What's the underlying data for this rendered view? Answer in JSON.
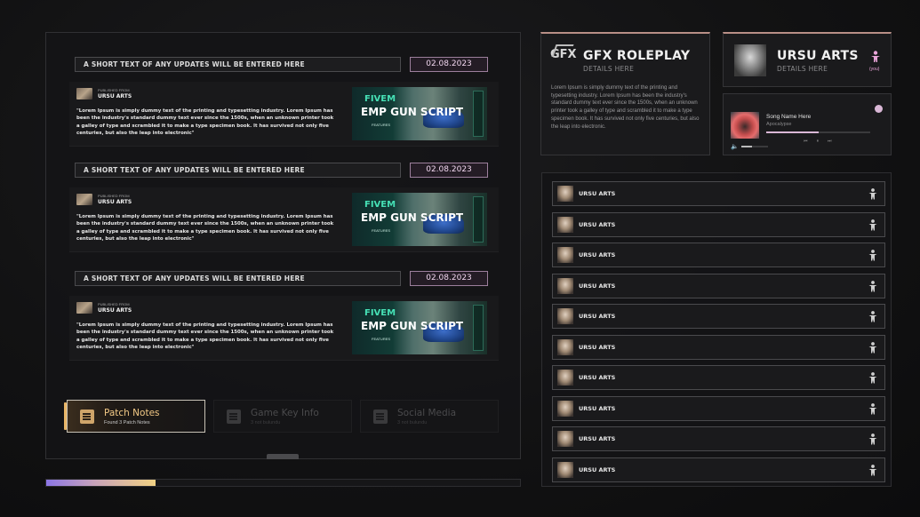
{
  "updates": [
    {
      "title": "A SHORT TEXT OF ANY UPDATES WILL BE ENTERED HERE",
      "date": "02.08.2023",
      "published_from": "PUBLISHED FROM",
      "author": "URSU ARTS",
      "text": "\"Lorem Ipsum is simply dummy text of the printing and typesetting industry. Lorem Ipsum has been the industry's standard dummy text ever since the 1500s, when an unknown printer took a galley of type and scrambled it to make a type specimen book. It has survived not only five centuries, but also the leap into electronic\"",
      "thumb_line1": "FIVEM",
      "thumb_line2": "EMP GUN SCRIPT",
      "thumb_line3": "FEATURES"
    },
    {
      "title": "A SHORT TEXT OF ANY UPDATES WILL BE ENTERED HERE",
      "date": "02.08.2023",
      "published_from": "PUBLISHED FROM",
      "author": "URSU ARTS",
      "text": "\"Lorem Ipsum is simply dummy text of the printing and typesetting industry. Lorem Ipsum has been the industry's standard dummy text ever since the 1500s, when an unknown printer took a galley of type and scrambled it to make a type specimen book. It has survived not only five centuries, but also the leap into electronic\"",
      "thumb_line1": "FIVEM",
      "thumb_line2": "EMP GUN SCRIPT",
      "thumb_line3": "FEATURES"
    },
    {
      "title": "A SHORT TEXT OF ANY UPDATES WILL BE ENTERED HERE",
      "date": "02.08.2023",
      "published_from": "PUBLISHED FROM",
      "author": "URSU ARTS",
      "text": "\"Lorem Ipsum is simply dummy text of the printing and typesetting industry. Lorem Ipsum has been the industry's standard dummy text ever since the 1500s, when an unknown printer took a galley of type and scrambled it to make a type specimen book. It has survived not only five centuries, but also the leap into electronic\"",
      "thumb_line1": "FIVEM",
      "thumb_line2": "EMP GUN SCRIPT",
      "thumb_line3": "FEATURES"
    }
  ],
  "tabs": [
    {
      "label": "Patch Notes",
      "sub": "Found 3 Patch Notes",
      "active": true,
      "icon": "notes-icon"
    },
    {
      "label": "Game Key Info",
      "sub": "3 not bulundu",
      "active": false,
      "icon": "notes-icon"
    },
    {
      "label": "Social Media",
      "sub": "3 not bulundu",
      "active": false,
      "icon": "notes-icon"
    }
  ],
  "progress": {
    "fraction": 0.23
  },
  "server_card": {
    "logo": "GFX",
    "title": "GFX ROLEPLAY",
    "subtitle": "DETAILS HERE",
    "text": "Lorem Ipsum is simply dummy text of the printing and typesetting industry. Lorem Ipsum has been the industry's standard dummy text ever since the 1500s, when an unknown printer took a galley of type and scrambled it to make a type specimen book. It has survived not only five centuries, but also the leap into electronic."
  },
  "profile_card": {
    "title": "URSU ARTS",
    "subtitle": "DETAILS HERE",
    "you_label": "(you)",
    "accent": "#e8a4d8"
  },
  "music_player": {
    "song": "Song Name Here",
    "artist": "Apocalypse",
    "progress_fraction": 0.5,
    "volume_fraction": 0.4
  },
  "player_list": [
    "URSU ARTS",
    "URSU ARTS",
    "URSU ARTS",
    "URSU ARTS",
    "URSU ARTS",
    "URSU ARTS",
    "URSU ARTS",
    "URSU ARTS",
    "URSU ARTS",
    "URSU ARTS"
  ],
  "colors": {
    "accent_gold": "#f2c885",
    "accent_pink": "#e8a4d8",
    "date_border": "#9c7f9c"
  }
}
